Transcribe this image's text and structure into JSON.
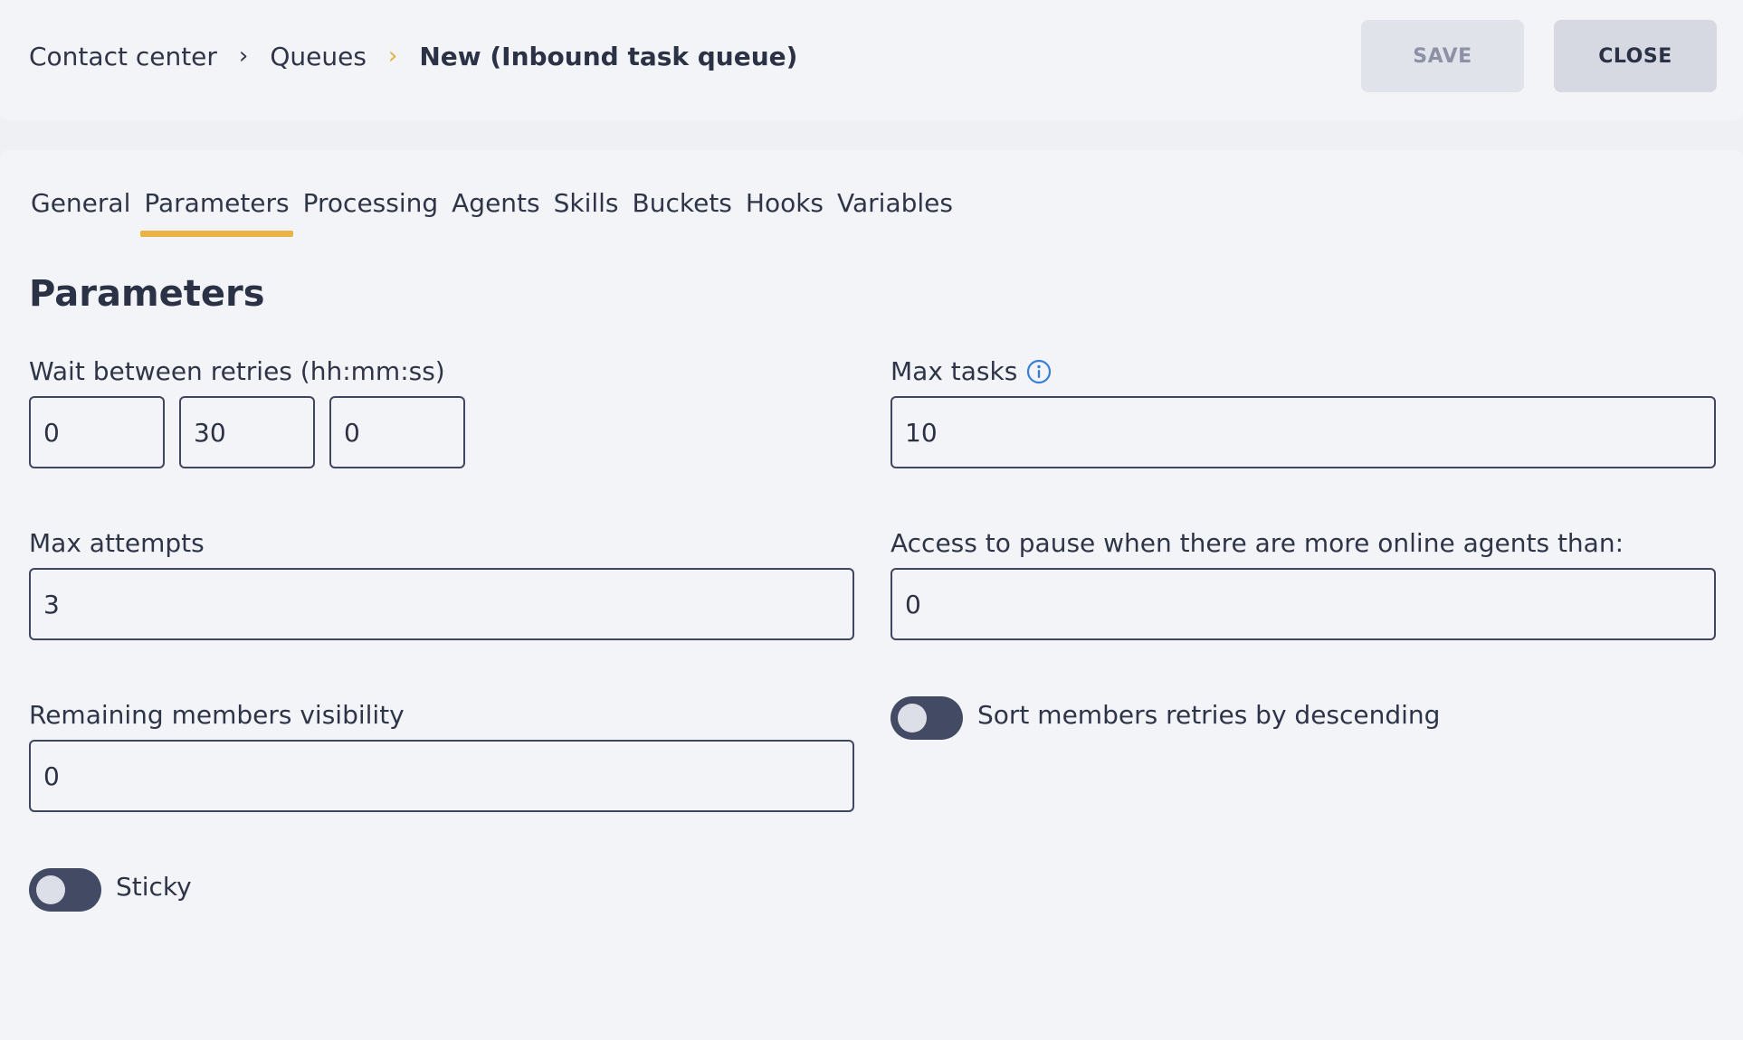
{
  "breadcrumb": {
    "items": [
      "Contact center",
      "Queues"
    ],
    "current": "New (Inbound task queue)"
  },
  "actions": {
    "save": "SAVE",
    "close": "CLOSE"
  },
  "tabs": [
    {
      "label": "General",
      "active": false
    },
    {
      "label": "Parameters",
      "active": true
    },
    {
      "label": "Processing",
      "active": false
    },
    {
      "label": "Agents",
      "active": false
    },
    {
      "label": "Skills",
      "active": false
    },
    {
      "label": "Buckets",
      "active": false
    },
    {
      "label": "Hooks",
      "active": false
    },
    {
      "label": "Variables",
      "active": false
    }
  ],
  "section_title": "Parameters",
  "fields": {
    "wait_between_retries": {
      "label": "Wait between retries (hh:mm:ss)",
      "hours": "0",
      "minutes": "30",
      "seconds": "0"
    },
    "max_tasks": {
      "label": "Max tasks",
      "value": "10"
    },
    "max_attempts": {
      "label": "Max attempts",
      "value": "3"
    },
    "access_to_pause": {
      "label": "Access to pause when there are more online agents than:",
      "value": "0"
    },
    "remaining_members_visibility": {
      "label": "Remaining members visibility",
      "value": "0"
    }
  },
  "toggles": {
    "sort_desc": {
      "label": "Sort members retries by descending",
      "on": false
    },
    "sticky": {
      "label": "Sticky",
      "on": false
    }
  },
  "colors": {
    "accent": "#eab445",
    "info": "#3a7fd6",
    "toggle_track": "#434a64"
  }
}
